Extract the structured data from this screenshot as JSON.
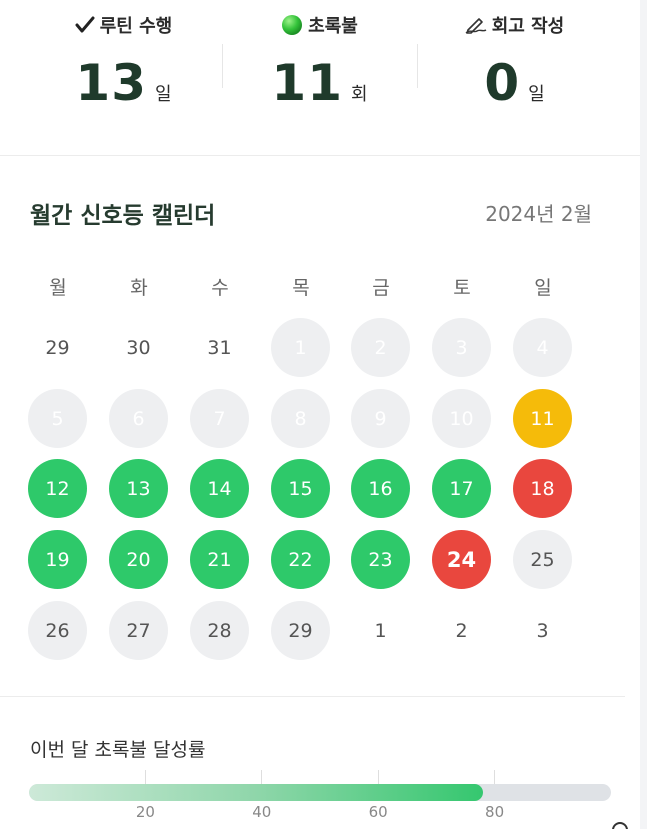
{
  "stats": [
    {
      "icon": "checkmark-icon",
      "label": "루틴 수행",
      "value": "13",
      "unit": "일"
    },
    {
      "icon": "green-light-icon",
      "label": "초록불",
      "value": "11",
      "unit": "회"
    },
    {
      "icon": "pen-icon",
      "label": "회고 작성",
      "value": "0",
      "unit": "일"
    }
  ],
  "calendar": {
    "title": "월간 신호등 캘린더",
    "month": "2024년 2월",
    "weekdays": [
      "월",
      "화",
      "수",
      "목",
      "금",
      "토",
      "일"
    ],
    "days": [
      {
        "n": "29",
        "s": "outside"
      },
      {
        "n": "30",
        "s": "outside"
      },
      {
        "n": "31",
        "s": "outside"
      },
      {
        "n": "1",
        "s": "future"
      },
      {
        "n": "2",
        "s": "future"
      },
      {
        "n": "3",
        "s": "future"
      },
      {
        "n": "4",
        "s": "future"
      },
      {
        "n": "5",
        "s": "future"
      },
      {
        "n": "6",
        "s": "future"
      },
      {
        "n": "7",
        "s": "future"
      },
      {
        "n": "8",
        "s": "future"
      },
      {
        "n": "9",
        "s": "future"
      },
      {
        "n": "10",
        "s": "future"
      },
      {
        "n": "11",
        "s": "yellow"
      },
      {
        "n": "12",
        "s": "green"
      },
      {
        "n": "13",
        "s": "green"
      },
      {
        "n": "14",
        "s": "green"
      },
      {
        "n": "15",
        "s": "green"
      },
      {
        "n": "16",
        "s": "green"
      },
      {
        "n": "17",
        "s": "green"
      },
      {
        "n": "18",
        "s": "red"
      },
      {
        "n": "19",
        "s": "green"
      },
      {
        "n": "20",
        "s": "green"
      },
      {
        "n": "21",
        "s": "green"
      },
      {
        "n": "22",
        "s": "green"
      },
      {
        "n": "23",
        "s": "green"
      },
      {
        "n": "24",
        "s": "red today"
      },
      {
        "n": "25",
        "s": "past"
      },
      {
        "n": "26",
        "s": "past"
      },
      {
        "n": "27",
        "s": "past"
      },
      {
        "n": "28",
        "s": "past"
      },
      {
        "n": "29",
        "s": "past"
      },
      {
        "n": "1",
        "s": "plain"
      },
      {
        "n": "2",
        "s": "plain"
      },
      {
        "n": "3",
        "s": "plain"
      }
    ]
  },
  "progress": {
    "title": "이번 달 초록불 달성률",
    "percent": 78,
    "ticks": [
      "20",
      "40",
      "60",
      "80"
    ]
  },
  "colors": {
    "green": "#2ec96a",
    "red": "#e9473e",
    "yellow": "#f5bb0a",
    "empty": "#eeeff1"
  }
}
